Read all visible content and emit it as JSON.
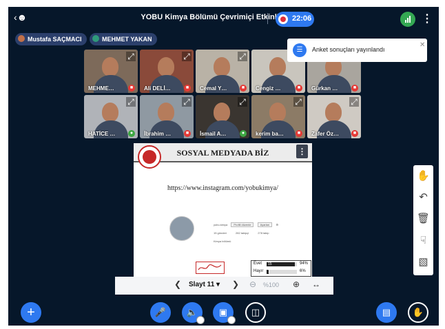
{
  "topbar": {
    "user_icon": "user-list-icon",
    "title": "YOBU Kimya Bölümü Çevrimiçi Etkinlik Odası",
    "record_time": "22:06",
    "connection_icon": "signal-bars-icon",
    "more_icon": "more-vertical-icon"
  },
  "presenters": [
    {
      "name": "Mustafa SAÇMACI",
      "color": "#c0704a"
    },
    {
      "name": "MEHMET YAKAN",
      "color": "#2f9a7a"
    }
  ],
  "videos": [
    {
      "name": "MEHME…",
      "mic": "muted",
      "bg": "#7d6a5a"
    },
    {
      "name": "Ali DELİ…",
      "mic": "muted",
      "bg": "#8a4a3a"
    },
    {
      "name": "Cemal Y…",
      "mic": "muted",
      "bg": "#b9b2a6"
    },
    {
      "name": "Cengiz …",
      "mic": "muted",
      "bg": "#c9c5bd"
    },
    {
      "name": "Gürkan …",
      "mic": "muted",
      "bg": "#a9a59e"
    },
    {
      "name": "HATİCE …",
      "mic": "on",
      "bg": "#b0b3b8"
    },
    {
      "name": "İbrahim …",
      "mic": "muted",
      "bg": "#8f99a2"
    },
    {
      "name": "İsmail A…",
      "mic": "on",
      "bg": "#3a3530"
    },
    {
      "name": "kerim ba…",
      "mic": "muted",
      "bg": "#8c7b66"
    },
    {
      "name": "Zafer Öz…",
      "mic": "muted",
      "bg": "#cfcac3"
    }
  ],
  "slide": {
    "title": "SOSYAL MEDYADA BİZ",
    "url": "https://www.instagram.com/yobukimya/",
    "options_icon": "more-vertical-icon",
    "ig_handle": "yobu.kimya",
    "ig_btn_follow": "Profili düzenle",
    "ig_btn_share": "Ayarları",
    "ig_posts": "15 gönderi",
    "ig_followers": "282 takipçi",
    "ig_following": "278 takip",
    "ig_bio": "Kimya bölümü",
    "signature": "YOBU"
  },
  "poll": {
    "rows": [
      {
        "label": "Evet",
        "count": "15",
        "percent": "94%",
        "fraction": 0.94
      },
      {
        "label": "Hayır",
        "count": "1",
        "percent": "6%",
        "fraction": 0.06
      }
    ]
  },
  "slide_nav": {
    "prev_icon": "chevron-left-icon",
    "slide_label": "Slayt 11",
    "next_icon": "chevron-right-icon",
    "zoom_out_icon": "zoom-out-icon",
    "zoom": "%100",
    "zoom_in_icon": "zoom-in-icon",
    "fit_icon": "fit-width-icon"
  },
  "toast": {
    "icon": "poll-icon",
    "text": "Anket sonuçları yayınlandı",
    "close": "close-icon"
  },
  "tools": [
    "hand-icon",
    "undo-icon",
    "trash-icon",
    "multi-user-icon",
    "whiteboard-icon"
  ],
  "bottom_actions": [
    "plus-icon",
    "microphone-icon",
    "audio-icon",
    "camera-icon",
    "screen-share-icon",
    "presentation-icon",
    "raise-hand-icon"
  ]
}
